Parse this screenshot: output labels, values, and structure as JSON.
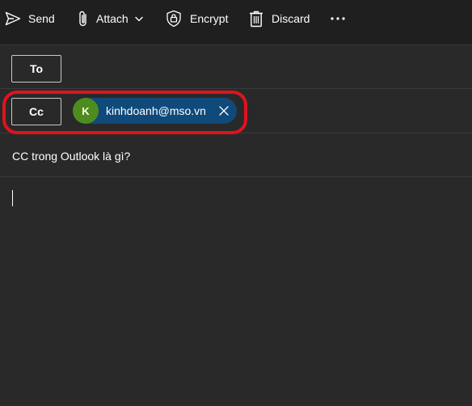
{
  "toolbar": {
    "send_label": "Send",
    "attach_label": "Attach",
    "encrypt_label": "Encrypt",
    "discard_label": "Discard",
    "more_icon": "more-horizontal-icon"
  },
  "fields": {
    "to_label": "To",
    "cc_label": "Cc",
    "cc_recipients": [
      {
        "initial": "K",
        "email": "kinhdoanh@mso.vn",
        "avatar_color": "#4e8c1d"
      }
    ],
    "subject": "CC trong Outlook là gì?"
  },
  "colors": {
    "background": "#1f1f1f",
    "compose_background": "#292929",
    "chip_background": "#0f4a7a",
    "highlight": "#e0131f"
  }
}
